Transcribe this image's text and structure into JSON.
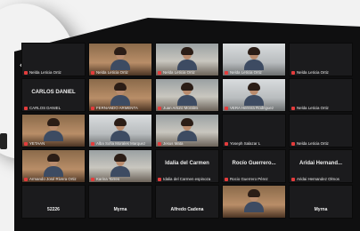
{
  "window": {
    "prev_arrow": "‹",
    "next_arrow": "›"
  },
  "tiles": [
    {
      "label": "Nelda Leticia Ortiz",
      "center": "",
      "kind": "dark"
    },
    {
      "label": "Nelda Leticia Ortiz",
      "center": "",
      "kind": "warm"
    },
    {
      "label": "Nelda Leticia Ortiz",
      "center": "",
      "kind": "alt"
    },
    {
      "label": "Nelda Leticia Ortiz",
      "center": "",
      "kind": "cool"
    },
    {
      "label": "Nelda Leticia Ortiz",
      "center": "",
      "kind": "dark"
    },
    {
      "label": "CARLOS DANIEL",
      "center": "CARLOS DANIEL",
      "kind": "dark"
    },
    {
      "label": "FERNANDO ARMENTA",
      "center": "",
      "kind": "warm"
    },
    {
      "label": "Juan Arturo Morales",
      "center": "",
      "kind": "alt"
    },
    {
      "label": "VERA Herrera Rodriguez",
      "center": "",
      "kind": "cool"
    },
    {
      "label": "Nelda Leticia Ortiz",
      "center": "",
      "kind": "dark"
    },
    {
      "label": "YETAAN",
      "center": "",
      "kind": "warm"
    },
    {
      "label": "Alba Sofia Morales Marquez",
      "center": "",
      "kind": "cool"
    },
    {
      "label": "Jesus Mata",
      "center": "",
      "kind": "alt"
    },
    {
      "label": "Yoseph Salazar L",
      "center": "",
      "kind": "dark"
    },
    {
      "label": "Nelda Leticia Ortiz",
      "center": "",
      "kind": "dark"
    },
    {
      "label": "Armando José Rivera Ortiz",
      "center": "",
      "kind": "warm"
    },
    {
      "label": "Karina Torres",
      "center": "",
      "kind": "alt"
    },
    {
      "label": "Idalia del Carmen espinoza",
      "center": "Idalia del Carmen",
      "kind": "dark"
    },
    {
      "label": "Rocio Guerrero Pérez",
      "center": "Rocío Guerrero...",
      "kind": "dark"
    },
    {
      "label": "Aridai Hernandez Olmos",
      "center": "Aridai Hernand...",
      "kind": "dark"
    },
    {
      "label": "",
      "center": "52226",
      "kind": "dark"
    },
    {
      "label": "",
      "center": "Myrna",
      "kind": "dark"
    },
    {
      "label": "",
      "center": "Alfredo Cadena",
      "kind": "dark"
    },
    {
      "label": "",
      "center": "",
      "kind": "warm"
    },
    {
      "label": "",
      "center": "Myrna",
      "kind": "dark"
    }
  ]
}
